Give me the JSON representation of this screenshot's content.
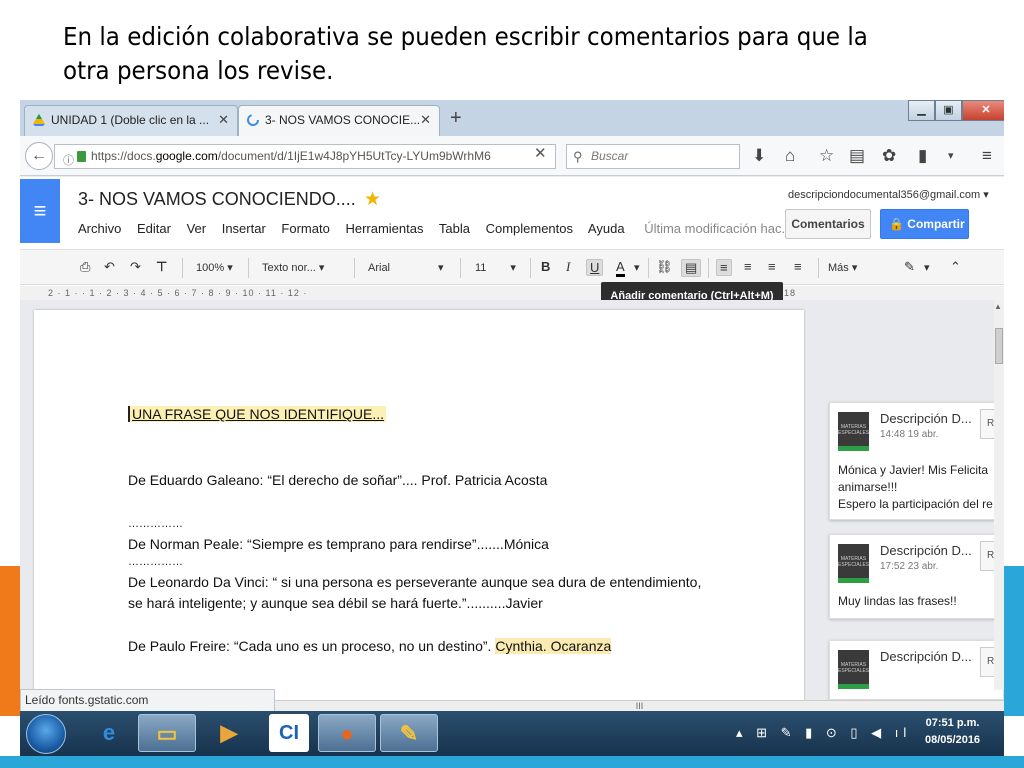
{
  "slide": {
    "title": "En la edición colaborativa se pueden escribir comentarios para que la otra persona los revise."
  },
  "browser": {
    "tabs": [
      {
        "label": "UNIDAD 1 (Doble clic en la ...",
        "icon": "google-drive-icon"
      },
      {
        "label": "3- NOS VAMOS CONOCIE...",
        "icon": "loading-icon"
      }
    ],
    "new_tab": "+",
    "url_prefix": "https://docs.",
    "url_domain": "google.com",
    "url_suffix": "/document/d/1IjE1w4J8pYH5UtTcy-LYUm9bWrhM6",
    "search_placeholder": "Buscar",
    "status_text": "Leído fonts.gstatic.com"
  },
  "docs": {
    "title": "3- NOS VAMOS CONOCIENDO....",
    "menu": [
      "Archivo",
      "Editar",
      "Ver",
      "Insertar",
      "Formato",
      "Herramientas",
      "Tabla",
      "Complementos",
      "Ayuda"
    ],
    "last_modified": "Última modificación hac...",
    "user_email": "descripciondocumental356@gmail.com",
    "comments_label": "Comentarios",
    "share_label": "Compartir",
    "toolbar": {
      "zoom": "100%",
      "style": "Texto nor...",
      "font": "Arial",
      "size": "11",
      "more": "Más"
    },
    "tooltip": "Añadir comentario (Ctrl+Alt+M)",
    "ruler": "2 · 1 · · 1 · 2 · 3 · 4 · 5 · 6 · 7 · 8 · 9 · 10 · 11 · 12 ·",
    "ruler_end": "18"
  },
  "document": {
    "heading": "UNA FRASE QUE NOS IDENTIFIQUE...",
    "line1": "De Eduardo Galeano: “El derecho de soñar”....       Prof. Patricia Acosta",
    "dots1": "……………",
    "line2": "De Norman Peale: “Siempre es temprano para rendirse”.......Mónica",
    "dots2": "……………",
    "line3": "De Leonardo Da Vinci: “ si una persona es perseverante aunque sea dura de entendimiento,",
    "line4": "se hará inteligente; y aunque sea débil se hará fuerte.”..........Javier",
    "line5": "De Paulo Freire: “Cada uno es un proceso, no un destino”.",
    "line5_highlight": "Cynthia. Ocaranza"
  },
  "comments": [
    {
      "author": "Descripción D...",
      "date": "14:48 19 abr.",
      "reply": "Re",
      "lines": [
        "Mónica y Javier! Mis Felicita",
        "animarse!!!",
        "Espero la participación del re"
      ]
    },
    {
      "author": "Descripción D...",
      "date": "17:52 23 abr.",
      "reply": "Re",
      "lines": [
        "Muy lindas las frases!!"
      ]
    },
    {
      "author": "Descripción D...",
      "date": "",
      "reply": "Re",
      "lines": []
    }
  ],
  "thumb_text": "MATERIAS ESPECIALES",
  "hscroll_grip": "III",
  "taskbar": {
    "time": "07:51 p.m.",
    "date": "08/05/2016"
  },
  "colors": {
    "docs_blue": "#4285f4",
    "highlight": "#fbeab1",
    "taskbar": "#17334d",
    "accent_orange": "#f07a1a",
    "accent_blue": "#2aa7d8"
  }
}
